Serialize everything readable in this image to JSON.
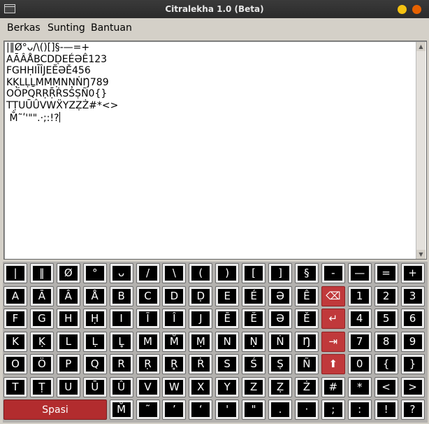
{
  "window": {
    "title": "Citralekha 1.0 (Beta)"
  },
  "menu": {
    "items": [
      "Berkas",
      "Sunting",
      "Bantuan"
    ]
  },
  "editor": {
    "lines": [
      "|‖Ø°ᴗ/\\()[]§-—=+",
      "AĀÂÅBCDḌEÉƏÊ123",
      "FGHḤIĪÎJEĔƏĚ456",
      "KḲLḶḺMMṂNṆṄŊ789",
      "OÖPQRṚṜṘSŚṢÑ0{}",
      "TṬUŪÛVWẌYZẒŻ#*<>",
      " M̐˜ʹ'\"\".·;:!?"
    ]
  },
  "keyboard": {
    "rows": [
      [
        {
          "label": "|",
          "name": "key-pipe"
        },
        {
          "label": "‖",
          "name": "key-double-pipe"
        },
        {
          "label": "Ø",
          "name": "key-o-slash"
        },
        {
          "label": "°",
          "name": "key-degree"
        },
        {
          "label": "ᴗ",
          "name": "key-breve-below"
        },
        {
          "label": "/",
          "name": "key-slash"
        },
        {
          "label": "\\",
          "name": "key-backslash"
        },
        {
          "label": "(",
          "name": "key-paren-open"
        },
        {
          "label": ")",
          "name": "key-paren-close"
        },
        {
          "label": "[",
          "name": "key-bracket-open"
        },
        {
          "label": "]",
          "name": "key-bracket-close"
        },
        {
          "label": "§",
          "name": "key-section"
        },
        {
          "label": "-",
          "name": "key-hyphen"
        },
        {
          "label": "—",
          "name": "key-em-dash"
        },
        {
          "label": "=",
          "name": "key-equals"
        },
        {
          "label": "+",
          "name": "key-plus"
        }
      ],
      [
        {
          "label": "A",
          "name": "key-a"
        },
        {
          "label": "Ā",
          "name": "key-a-macron"
        },
        {
          "label": "Â",
          "name": "key-a-circumflex"
        },
        {
          "label": "Å",
          "name": "key-a-ring"
        },
        {
          "label": "B",
          "name": "key-b"
        },
        {
          "label": "C",
          "name": "key-c"
        },
        {
          "label": "D",
          "name": "key-d"
        },
        {
          "label": "Ḍ",
          "name": "key-d-dot-below"
        },
        {
          "label": "E",
          "name": "key-e"
        },
        {
          "label": "É",
          "name": "key-e-acute"
        },
        {
          "label": "Ə",
          "name": "key-schwa"
        },
        {
          "label": "Ê",
          "name": "key-e-circumflex"
        },
        {
          "label": "⌫",
          "name": "backspace-icon",
          "red": true
        },
        {
          "label": "1",
          "name": "key-1"
        },
        {
          "label": "2",
          "name": "key-2"
        },
        {
          "label": "3",
          "name": "key-3"
        }
      ],
      [
        {
          "label": "F",
          "name": "key-f"
        },
        {
          "label": "G",
          "name": "key-g"
        },
        {
          "label": "H",
          "name": "key-h"
        },
        {
          "label": "Ḥ",
          "name": "key-h-dot-below"
        },
        {
          "label": "I",
          "name": "key-i"
        },
        {
          "label": "Ī",
          "name": "key-i-macron"
        },
        {
          "label": "Î",
          "name": "key-i-circumflex"
        },
        {
          "label": "J",
          "name": "key-j"
        },
        {
          "label": "Ē",
          "name": "key-e-macron"
        },
        {
          "label": "Ĕ",
          "name": "key-e-breve"
        },
        {
          "label": "Ə",
          "name": "key-schwa-2"
        },
        {
          "label": "Ě",
          "name": "key-e-caron"
        },
        {
          "label": "↵",
          "name": "enter-icon",
          "red": true
        },
        {
          "label": "4",
          "name": "key-4"
        },
        {
          "label": "5",
          "name": "key-5"
        },
        {
          "label": "6",
          "name": "key-6"
        }
      ],
      [
        {
          "label": "K",
          "name": "key-k"
        },
        {
          "label": "Ḳ",
          "name": "key-k-dot-below"
        },
        {
          "label": "L",
          "name": "key-l"
        },
        {
          "label": "Ḷ",
          "name": "key-l-dot-below"
        },
        {
          "label": "L̥",
          "name": "key-l-ring-below"
        },
        {
          "label": "M",
          "name": "key-m"
        },
        {
          "label": "M̐",
          "name": "key-m-candrabindu"
        },
        {
          "label": "Ṃ",
          "name": "key-m-dot-below"
        },
        {
          "label": "N",
          "name": "key-n"
        },
        {
          "label": "Ṇ",
          "name": "key-n-dot-below"
        },
        {
          "label": "Ṅ",
          "name": "key-n-dot-above"
        },
        {
          "label": "Ŋ",
          "name": "key-eng"
        },
        {
          "label": "⇥",
          "name": "tab-icon",
          "red": true
        },
        {
          "label": "7",
          "name": "key-7"
        },
        {
          "label": "8",
          "name": "key-8"
        },
        {
          "label": "9",
          "name": "key-9"
        }
      ],
      [
        {
          "label": "O",
          "name": "key-o"
        },
        {
          "label": "Ö",
          "name": "key-o-umlaut"
        },
        {
          "label": "P",
          "name": "key-p"
        },
        {
          "label": "Q",
          "name": "key-q"
        },
        {
          "label": "R",
          "name": "key-r"
        },
        {
          "label": "Ṛ",
          "name": "key-r-dot-below"
        },
        {
          "label": "R̥",
          "name": "key-r-ring-below"
        },
        {
          "label": "Ṙ",
          "name": "key-r-dot-above"
        },
        {
          "label": "S",
          "name": "key-s"
        },
        {
          "label": "Ś",
          "name": "key-s-acute"
        },
        {
          "label": "Ṣ",
          "name": "key-s-dot-below"
        },
        {
          "label": "Ñ",
          "name": "key-n-tilde"
        },
        {
          "label": "⬆",
          "name": "shift-icon",
          "red": true
        },
        {
          "label": "0",
          "name": "key-0"
        },
        {
          "label": "{",
          "name": "key-brace-open"
        },
        {
          "label": "}",
          "name": "key-brace-close"
        }
      ],
      [
        {
          "label": "T",
          "name": "key-t"
        },
        {
          "label": "Ṭ",
          "name": "key-t-dot-below"
        },
        {
          "label": "U",
          "name": "key-u"
        },
        {
          "label": "Ū",
          "name": "key-u-macron"
        },
        {
          "label": "Û",
          "name": "key-u-circumflex"
        },
        {
          "label": "V",
          "name": "key-v"
        },
        {
          "label": "W",
          "name": "key-w"
        },
        {
          "label": "X",
          "name": "key-x"
        },
        {
          "label": "Y",
          "name": "key-y"
        },
        {
          "label": "Z",
          "name": "key-z"
        },
        {
          "label": "Ẓ",
          "name": "key-z-dot-below"
        },
        {
          "label": "Ż",
          "name": "key-z-dot-above"
        },
        {
          "label": "#",
          "name": "key-hash"
        },
        {
          "label": "*",
          "name": "key-asterisk"
        },
        {
          "label": "<",
          "name": "key-less-than"
        },
        {
          "label": ">",
          "name": "key-greater-than"
        }
      ],
      [
        {
          "label": "M̐",
          "name": "key-m-candrabindu-2"
        },
        {
          "label": "˜",
          "name": "key-tilde"
        },
        {
          "label": "ʼ",
          "name": "key-apostrophe-mod"
        },
        {
          "label": "ʻ",
          "name": "key-turned-comma"
        },
        {
          "label": "'",
          "name": "key-apostrophe"
        },
        {
          "label": "\"",
          "name": "key-quote"
        },
        {
          "label": ".",
          "name": "key-period"
        },
        {
          "label": "·",
          "name": "key-middle-dot"
        },
        {
          "label": ";",
          "name": "key-semicolon"
        },
        {
          "label": ":",
          "name": "key-colon"
        },
        {
          "label": "!",
          "name": "key-exclamation"
        },
        {
          "label": "?",
          "name": "key-question"
        }
      ]
    ],
    "space_label": "Spasi"
  }
}
